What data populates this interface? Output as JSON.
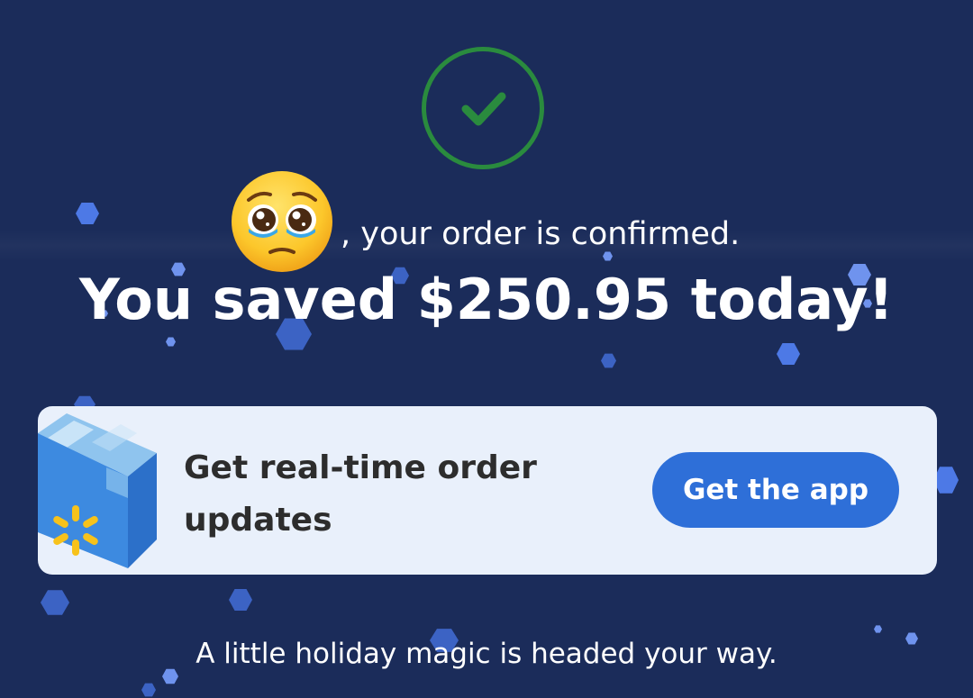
{
  "colors": {
    "background": "#1b2c5a",
    "success_green": "#2a8b3e",
    "card_background": "#e9f0fb",
    "button_blue": "#2e6fd8",
    "snowflake_blue": "#4d79e6",
    "walmart_spark_yellow": "#f7c21b"
  },
  "icons": {
    "success": "check-circle-icon",
    "user_avatar": "pleading-face-emoji",
    "package": "walmart-box-icon"
  },
  "confirmation": {
    "message": ", your order is confirmed."
  },
  "savings": {
    "headline": "You saved $250.95 today!"
  },
  "promo_card": {
    "text": "Get real-time order updates",
    "button_label": "Get the app"
  },
  "footer": {
    "tagline": "A little holiday magic is headed your way."
  }
}
